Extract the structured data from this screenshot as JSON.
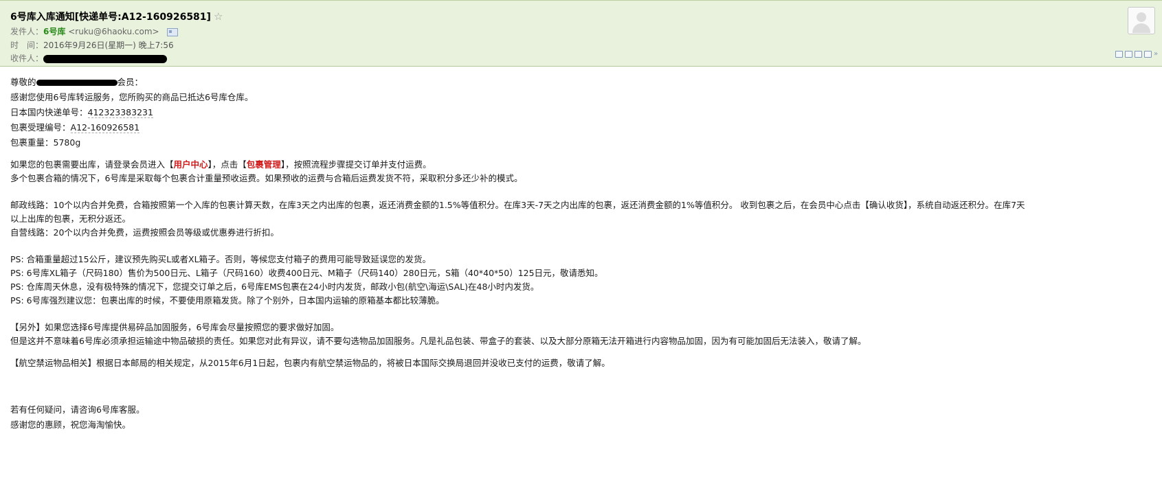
{
  "header": {
    "subject": "6号库入库通知[快递单号:A12-160926581]",
    "star": "☆",
    "from_label": "发件人：",
    "from_name": "6号库",
    "from_email": "<ruku@6haoku.com>",
    "time_label": "时　间：",
    "time_value": "2016年9月26日(星期一) 晚上7:56",
    "to_label": "收件人："
  },
  "body": {
    "greet_prefix": "尊敬的",
    "greet_suffix": "会员：",
    "thanks": "感谢您使用6号库转运服务，您所购买的商品已抵达6号库仓库。",
    "tracking_label": "日本国内快递单号：",
    "tracking_value": "412323383231",
    "pkg_label": "包裹受理编号：",
    "pkg_value": "A12-160926581",
    "weight_label": "包裹重量：",
    "weight_value": "5780g",
    "ship_a": "如果您的包裹需要出库，请登录会员进入【",
    "ship_link1": "用户中心",
    "ship_b": "】，点击【",
    "ship_link2": "包裹管理",
    "ship_c": "】，按照流程步骤提交订单并支付运费。",
    "multi": "多个包裹合箱的情况下，6号库是采取每个包裹合计重量预收运费。如果预收的运费与合箱后运费发货不符，采取积分多还少补的模式。",
    "postal_1": "邮政线路：10个以内合并免费，合箱按照第一个入库的包裹计算天数，在库3天之内出库的包裹，返还消费金额的1.5%等值积分。在库3天-7天之内出库的包裹，返还消费金额的1%等值积分。 收到包裹之后，在会员中心点击【确认收货】，系统自动返还积分。在库7天",
    "postal_2": "以上出库的包裹，无积分返还。",
    "self": "自营线路：20个以内合并免费，运费按照会员等级或优惠券进行折扣。",
    "ps1": "PS: 合箱重量超过15公斤，建议预先购买L或者XL箱子。否则，等候您支付箱子的费用可能导致延误您的发货。",
    "ps2": "PS: 6号库XL箱子（尺码180）售价为500日元、L箱子（尺码160）收费400日元、M箱子（尺码140）280日元，S箱（40*40*50）125日元，敬请悉知。",
    "ps3": "PS: 仓库周天休息，没有极特殊的情况下，您提交订单之后，6号库EMS包裹在24小时内发货，邮政小包(航空\\海运\\SAL)在48小时内发货。",
    "ps4": "PS: 6号库强烈建议您：包裹出库的时候，不要使用原箱发货。除了个别外，日本国内运输的原箱基本都比较薄脆。",
    "extra1": "【另外】如果您选择6号库提供易碎品加固服务，6号库会尽量按照您的要求做好加固。",
    "extra2": "但是这并不意味着6号库必须承担运输途中物品破损的责任。如果您对此有异议，请不要勾选物品加固服务。凡是礼品包装、带盒子的套装、以及大部分原箱无法开箱进行内容物品加固，因为有可能加固后无法装入，敬请了解。",
    "aviation": "【航空禁运物品相关】根据日本邮局的相关规定，从2015年6月1日起，包裹内有航空禁运物品的，将被日本国际交换局退回并没收已支付的运费，敬请了解。",
    "contact": "若有任何疑问，请咨询6号库客服。",
    "closing": "感谢您的惠顾，祝您海淘愉快。"
  },
  "icons": [
    "contact-card-icon",
    "avatar-icon",
    "window-icon",
    "print-icon",
    "more-chevron-icon"
  ],
  "colors": {
    "header_bg": "#e9f2dd",
    "sender": "#2a8a1b",
    "link_red": "#d11a1a"
  }
}
